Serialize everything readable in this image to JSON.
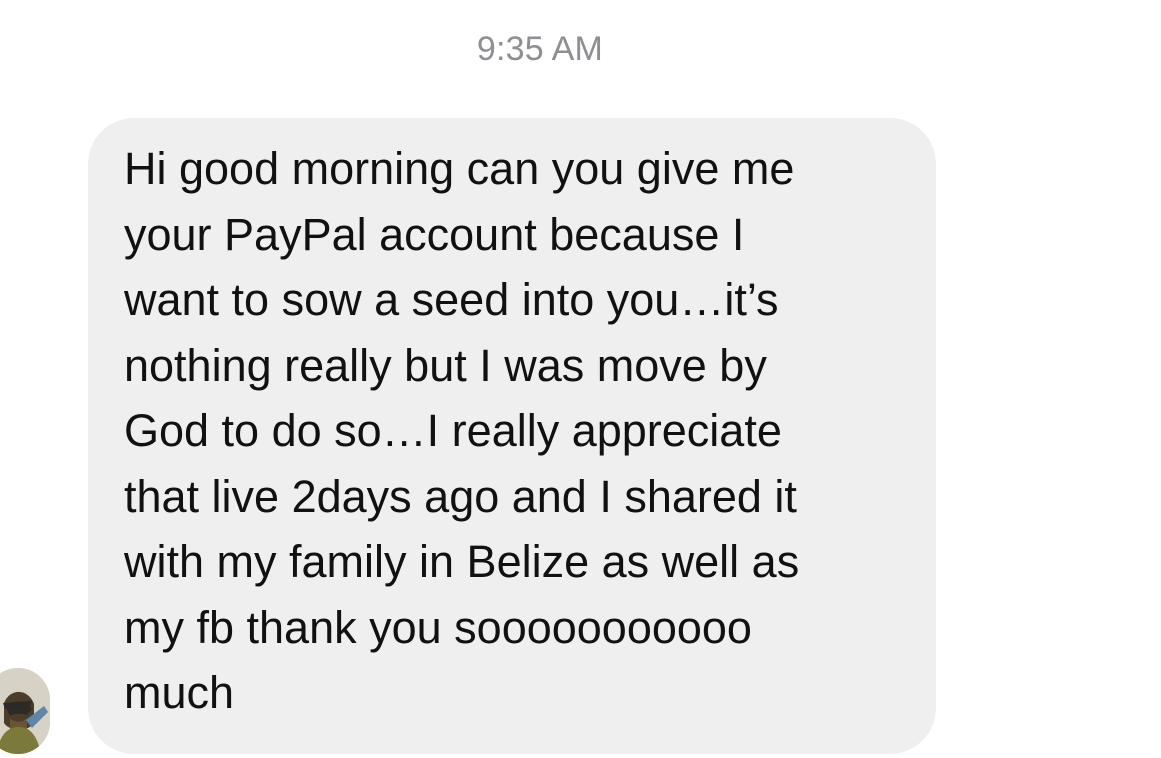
{
  "thread": {
    "timestamp": "9:35 AM",
    "messages": [
      {
        "sender_avatar_icon": "user-avatar-photo",
        "text": "Hi good morning can you give me\nyour PayPal account because I\nwant to sow a seed into you…it’s\nnothing really but I was move by\nGod to do so…I really appreciate\nthat live 2days ago and I shared it\nwith my family in Belize as well as\nmy fb thank you sooooooooooo\nmuch"
      }
    ]
  },
  "colors": {
    "bubble_background": "#efefef",
    "timestamp_text": "#8e8e93",
    "message_text": "#111111"
  }
}
